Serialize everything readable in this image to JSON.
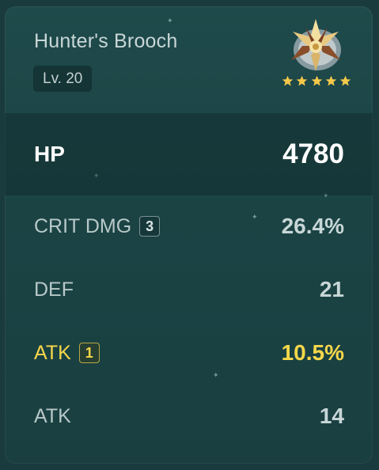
{
  "artifact": {
    "name": "Hunter's Brooch",
    "level": "Lv. 20",
    "rarity_stars": 5,
    "icon": "brooch-artifact-icon"
  },
  "main_stat": {
    "label": "HP",
    "value": "4780"
  },
  "substats": [
    {
      "label": "CRIT DMG",
      "badge": "3",
      "value": "26.4%",
      "highlight": false
    },
    {
      "label": "DEF",
      "badge": "",
      "value": "21",
      "highlight": false
    },
    {
      "label": "ATK",
      "badge": "1",
      "value": "10.5%",
      "highlight": true
    },
    {
      "label": "ATK",
      "badge": "",
      "value": "14",
      "highlight": false
    }
  ],
  "colors": {
    "background": "#1b4344",
    "highlight": "#f7d74a",
    "text": "#c7d6d6",
    "star": "#f5c84a"
  }
}
